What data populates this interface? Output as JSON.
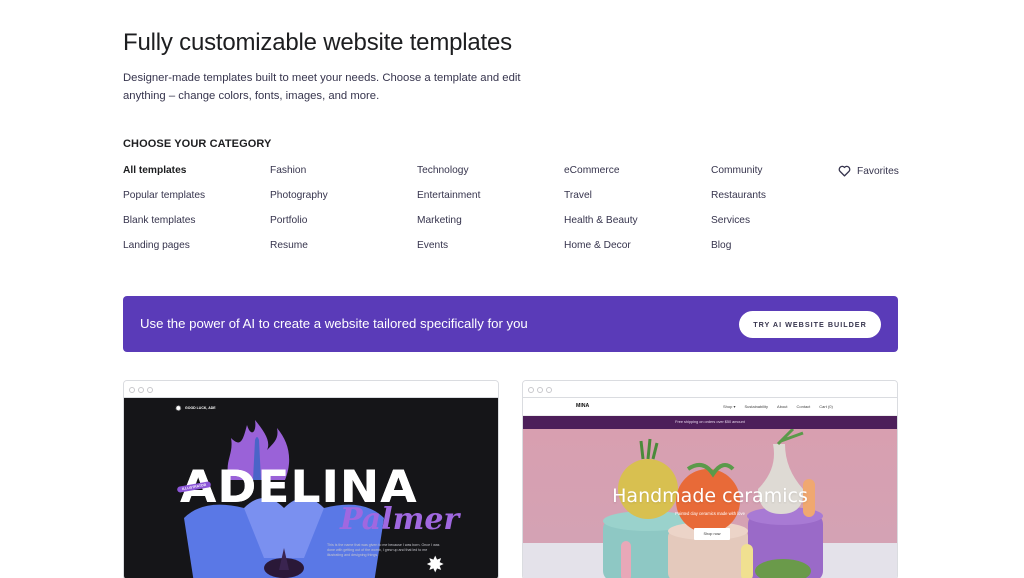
{
  "header": {
    "title": "Fully customizable website templates",
    "subtitle": "Designer-made templates built to meet your needs. Choose a template and edit anything – change colors, fonts, images, and more."
  },
  "categories": {
    "heading": "CHOOSE YOUR CATEGORY",
    "columns": [
      [
        "All templates",
        "Popular templates",
        "Blank templates",
        "Landing pages"
      ],
      [
        "Fashion",
        "Photography",
        "Portfolio",
        "Resume"
      ],
      [
        "Technology",
        "Entertainment",
        "Marketing",
        "Events"
      ],
      [
        "eCommerce",
        "Travel",
        "Health & Beauty",
        "Home & Decor"
      ],
      [
        "Community",
        "Restaurants",
        "Services",
        "Blog"
      ]
    ],
    "active": "All templates",
    "favorites_label": "Favorites",
    "favorites_icon": "heart-icon"
  },
  "ai_banner": {
    "text": "Use the power of AI to create a website tailored specifically for you",
    "button_label": "TRY AI WEBSITE BUILDER",
    "color": "#5a3bb8"
  },
  "templates": [
    {
      "name": "Adelina Palmer",
      "logo_text": "GOOD LUCK, ADE",
      "badge": "ILLUSTRATOR",
      "title": "ADELINA",
      "subtitle": "Palmer",
      "description": "This is the name that was given to me because I was born. Once I was done with getting out of the womb, I grew up and that led to me illustrating and designing things."
    },
    {
      "name": "Mina",
      "logo": "MINA",
      "nav": [
        "Shop ▾",
        "Sustainability",
        "About",
        "Contact",
        "Cart (0)"
      ],
      "announcement": "Free shipping on orders over $50 amount",
      "hero_title": "Handmade ceramics",
      "hero_subtitle": "Painted clay ceramics made with love",
      "hero_button": "Shop now"
    }
  ]
}
